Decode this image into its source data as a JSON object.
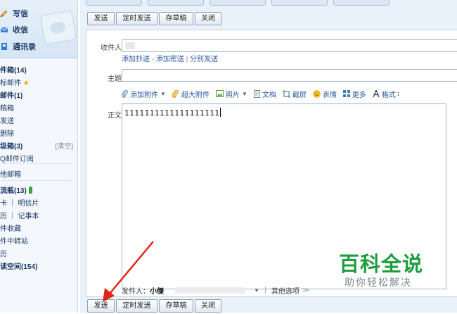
{
  "sidebar": {
    "write": "写信",
    "inbox": "收信",
    "contacts": "通讯录",
    "folders": [
      {
        "label": "件箱(14)",
        "bold": true
      },
      {
        "label": "标邮件",
        "star": true
      },
      {
        "label": "邮件(1)",
        "bold": true
      },
      {
        "label": "稿箱"
      },
      {
        "label": "发送"
      },
      {
        "label": "删除"
      },
      {
        "label": "圾箱(3)",
        "bold": true,
        "right": "[清空]"
      },
      {
        "label": "Q邮件订阅"
      },
      {
        "label": "他邮箱"
      },
      {
        "label": "流瓶(13)",
        "bold": true,
        "bottle": true
      },
      {
        "label": "卡 ｜ 明信片"
      },
      {
        "label": "历 ｜ 记事本"
      },
      {
        "label": "件收藏"
      },
      {
        "label": "件中转站"
      },
      {
        "label": "历"
      },
      {
        "label": "读空间(154)",
        "bold": true
      }
    ]
  },
  "toolbar": {
    "send": "发送",
    "scheduled": "定时发送",
    "draft": "存草稿",
    "close": "关闭"
  },
  "compose": {
    "recipient_label": "收件人",
    "add_cc": "添加抄送",
    "add_bcc": "添加密送",
    "separate": "分别发送",
    "sep1": " - ",
    "sep2": " | ",
    "subject_label": "主题",
    "attach": "添加附件",
    "big_attach": "超大附件",
    "photo": "照片",
    "doc": "文档",
    "screenshot": "截屏",
    "emoji": "表情",
    "more": "更多",
    "format": "格式",
    "body_label": "正文",
    "body_text": "1111111111111111111",
    "sender_label": "发件人：",
    "sender_name": "小傑",
    "other_options": "其他选项"
  },
  "watermark": {
    "title": "百科全说",
    "subtitle": "助你轻松解决"
  },
  "colors": {
    "accent": "#2859a0",
    "watermark_green": "#1e9e3d",
    "arrow": "#e0251b"
  }
}
